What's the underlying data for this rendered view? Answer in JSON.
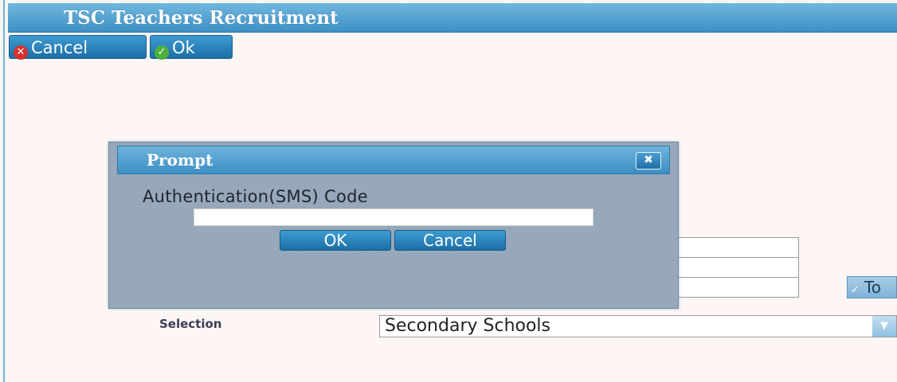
{
  "header": {
    "title": "TSC Teachers Recruitment"
  },
  "toolbar": {
    "cancel_label": "Cancel",
    "cancel_icon": "x-circle-icon",
    "ok_label": "Ok",
    "ok_icon": "check-circle-icon"
  },
  "form": {
    "selection_label": "Selection",
    "selection_value": "Secondary Schools",
    "partial_button_label": "To"
  },
  "dialog": {
    "title": "Prompt",
    "close_icon": "close-icon",
    "prompt_label": "Authentication(SMS) Code",
    "input_value": "",
    "ok_label": "OK",
    "cancel_label": "Cancel"
  },
  "colors": {
    "header_blue": "#3f8fc4",
    "dialog_body": "#96a8b9",
    "page_bg": "#fdf6f5"
  }
}
